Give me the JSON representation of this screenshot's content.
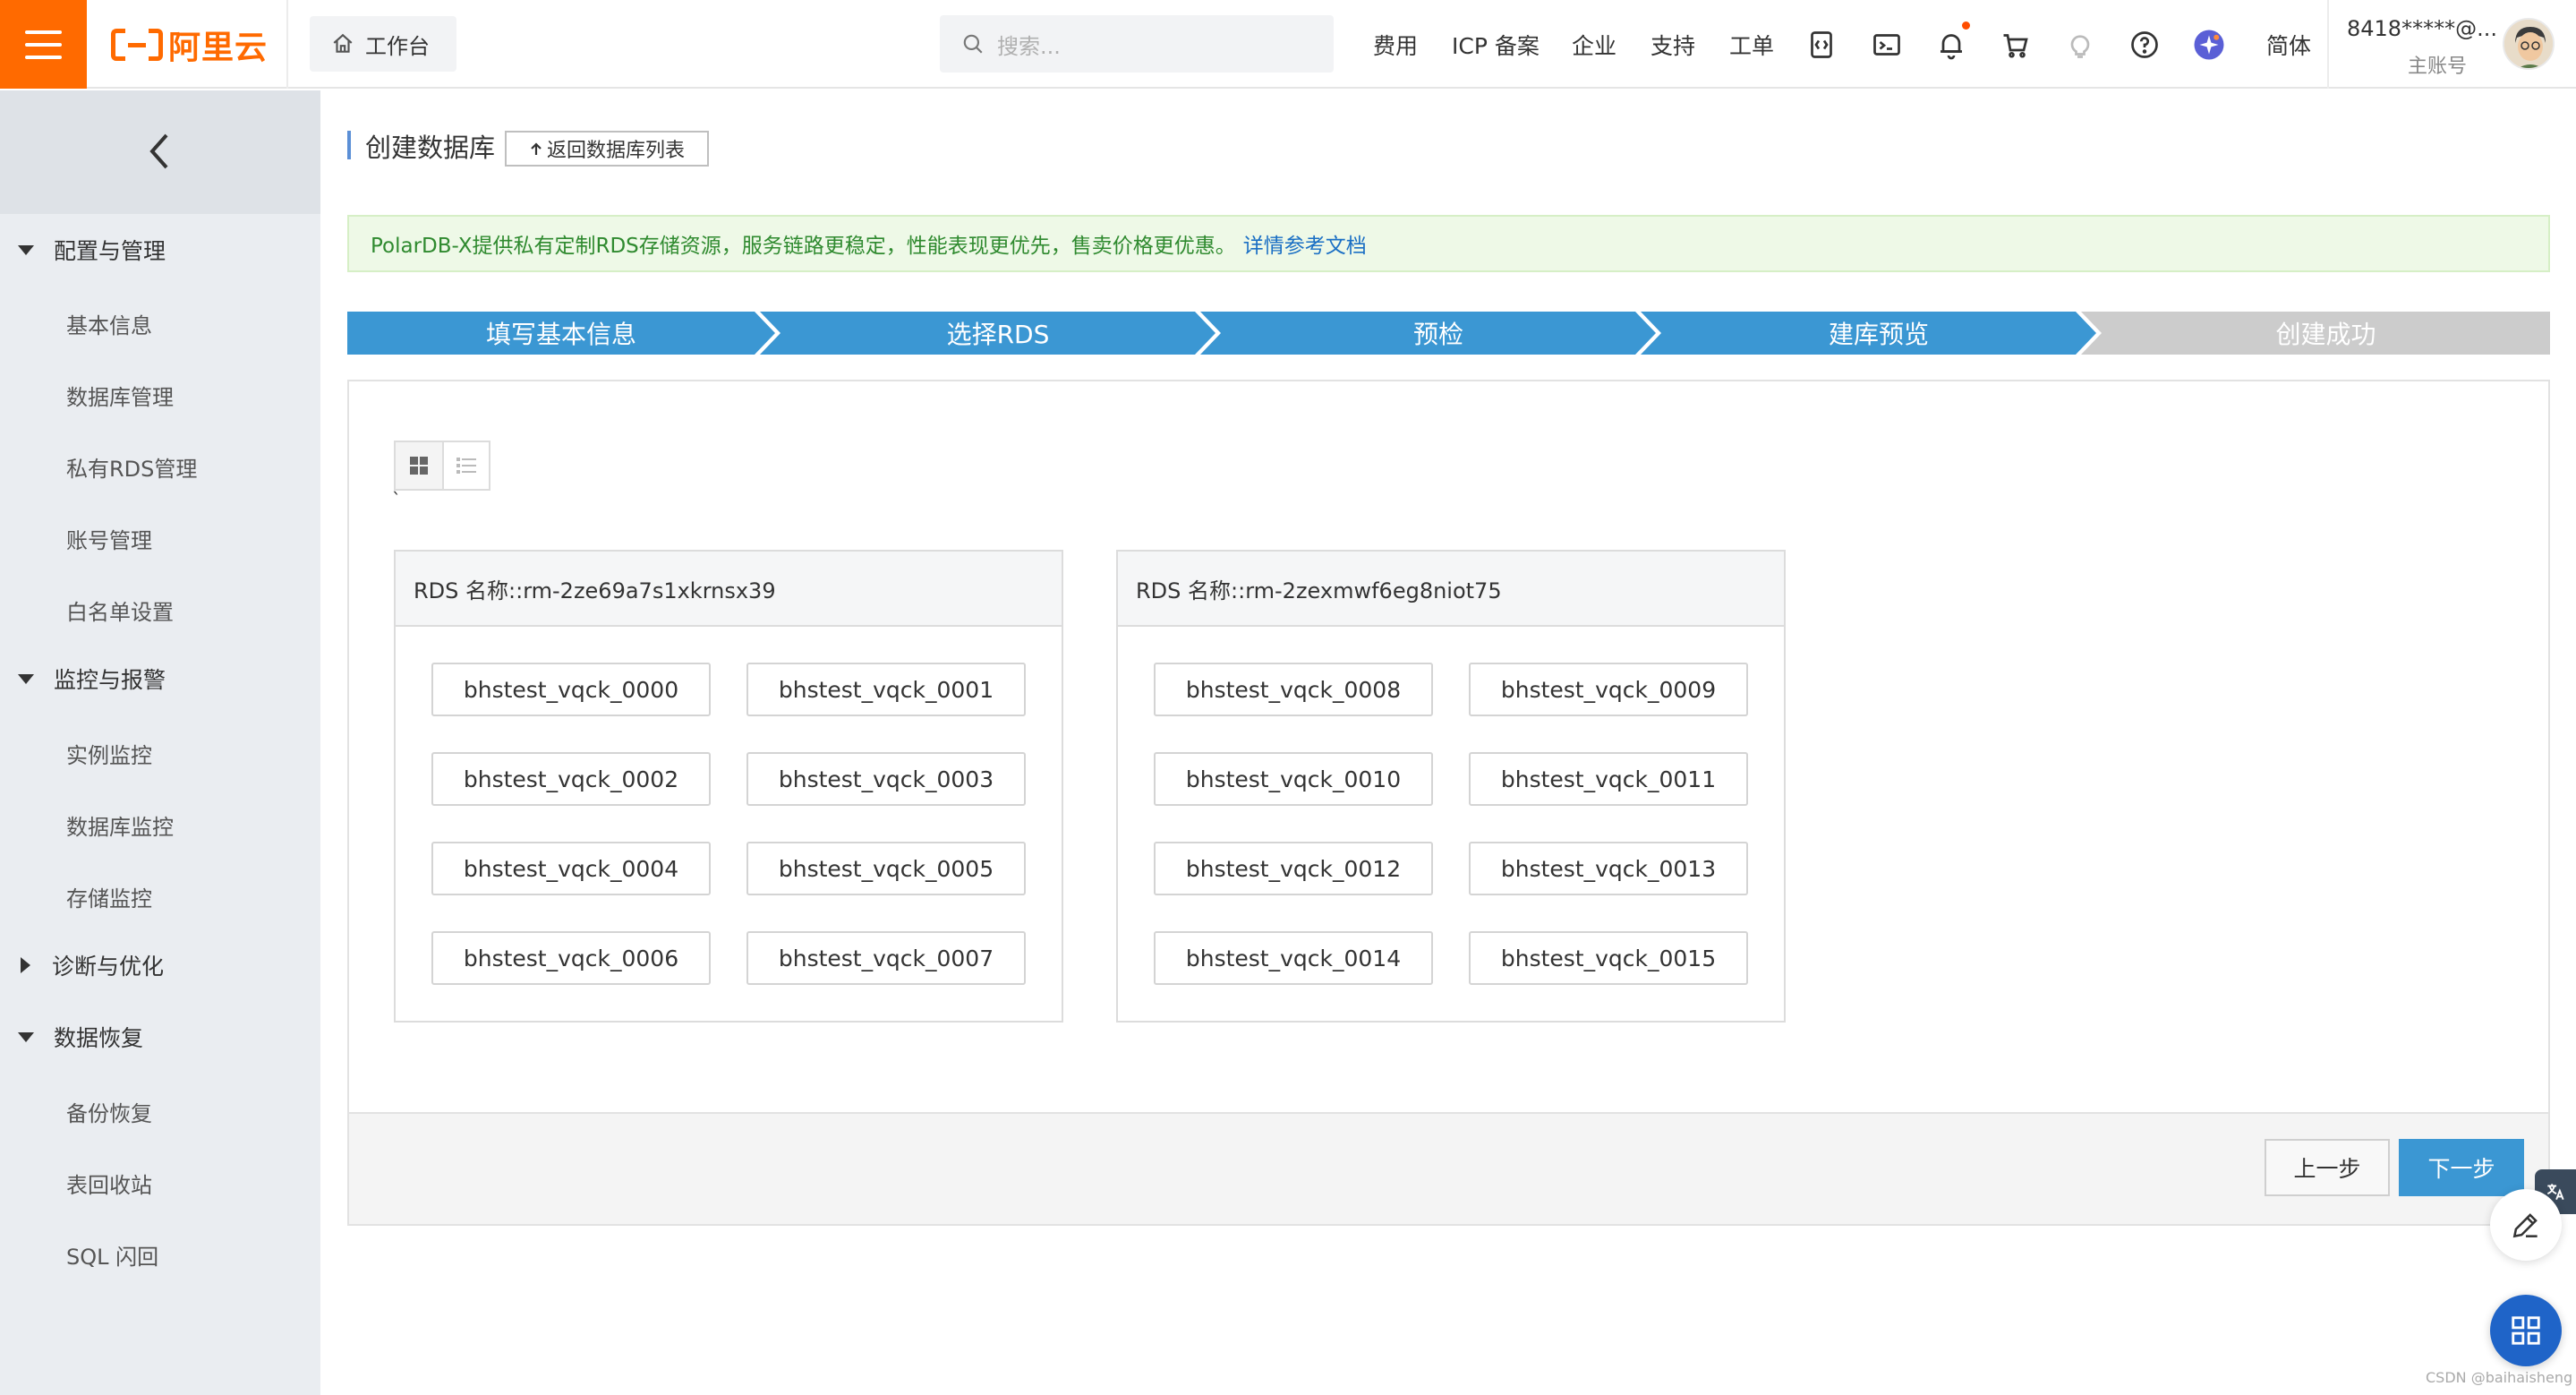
{
  "brand": {
    "logo_text": "阿里云",
    "accent": "#ff6a00"
  },
  "header": {
    "workbench_label": "工作台",
    "search_placeholder": "搜索...",
    "nav": [
      "费用",
      "ICP 备案",
      "企业",
      "支持",
      "工单"
    ],
    "lang_label": "简体",
    "account_id": "8418*****@...",
    "account_role": "主账号",
    "icons": [
      "code-icon",
      "terminal-icon",
      "bell-icon",
      "cart-icon",
      "lightbulb-icon",
      "help-icon",
      "ai-assistant-icon"
    ]
  },
  "sidebar": {
    "groups": [
      {
        "label": "配置与管理",
        "expanded": true,
        "items": [
          "基本信息",
          "数据库管理",
          "私有RDS管理",
          "账号管理",
          "白名单设置"
        ]
      },
      {
        "label": "监控与报警",
        "expanded": true,
        "items": [
          "实例监控",
          "数据库监控",
          "存储监控"
        ]
      },
      {
        "label": "诊断与优化",
        "expanded": false,
        "items": []
      },
      {
        "label": "数据恢复",
        "expanded": true,
        "items": [
          "备份恢复",
          "表回收站",
          "SQL 闪回"
        ]
      }
    ]
  },
  "main": {
    "title": "创建数据库",
    "back_button": "返回数据库列表",
    "notice_text": "PolarDB-X提供私有定制RDS存储资源，服务链路更稳定，性能表现更优先，售卖价格更优惠。",
    "notice_link": "详情参考文档",
    "steps": [
      {
        "label": "填写基本信息",
        "state": "done"
      },
      {
        "label": "选择RDS",
        "state": "done"
      },
      {
        "label": "预检",
        "state": "done"
      },
      {
        "label": "建库预览",
        "state": "active"
      },
      {
        "label": "创建成功",
        "state": "pending"
      }
    ],
    "step_colors": {
      "done": "#3b97d3",
      "pending": "#cccccc"
    },
    "tick_mark": "`",
    "rds_cards": [
      {
        "name": "RDS 名称::rm-2ze69a7s1xkrnsx39",
        "databases": [
          "bhstest_vqck_0000",
          "bhstest_vqck_0001",
          "bhstest_vqck_0002",
          "bhstest_vqck_0003",
          "bhstest_vqck_0004",
          "bhstest_vqck_0005",
          "bhstest_vqck_0006",
          "bhstest_vqck_0007"
        ]
      },
      {
        "name": "RDS 名称::rm-2zexmwf6eg8niot75",
        "databases": [
          "bhstest_vqck_0008",
          "bhstest_vqck_0009",
          "bhstest_vqck_0010",
          "bhstest_vqck_0011",
          "bhstest_vqck_0012",
          "bhstest_vqck_0013",
          "bhstest_vqck_0014",
          "bhstest_vqck_0015"
        ]
      }
    ],
    "prev_button": "上一步",
    "next_button": "下一步"
  },
  "watermark": "CSDN @baihaisheng"
}
